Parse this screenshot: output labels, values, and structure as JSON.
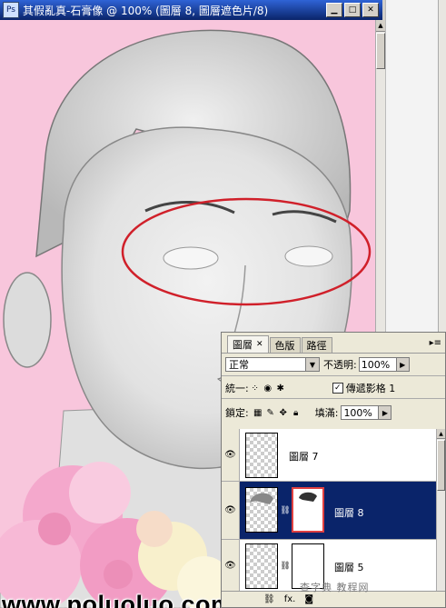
{
  "window": {
    "title": "其假亂真-石膏像 @ 100% (圖層 8, 圖層遮色片/8)",
    "app_icon": "photoshop-document-icon"
  },
  "canvas": {
    "background_color": "#f8c6dc",
    "annotation_color": "#d0202a"
  },
  "watermark": {
    "text": "www.poluoluo.com",
    "corner_stamp": "查字典 教程网"
  },
  "layers_panel": {
    "tabs": [
      {
        "label": "圖層",
        "active": true
      },
      {
        "label": "色版",
        "active": false
      },
      {
        "label": "路徑",
        "active": false
      }
    ],
    "blend_mode": "正常",
    "opacity_label": "不透明:",
    "opacity_value": "100%",
    "unify_label": "統一:",
    "propagate_label": "傳遞影格 1",
    "propagate_checked": "✓",
    "lock_label": "鎖定:",
    "fill_label": "填滿:",
    "fill_value": "100%",
    "layers": [
      {
        "name": "圖層 7",
        "selected": false
      },
      {
        "name": "圖層 8",
        "selected": true
      },
      {
        "name": "圖層 5",
        "selected": false
      }
    ],
    "footer_icons": [
      "link-icon",
      "fx-icon",
      "mask-icon"
    ],
    "fx_label": "fx."
  }
}
